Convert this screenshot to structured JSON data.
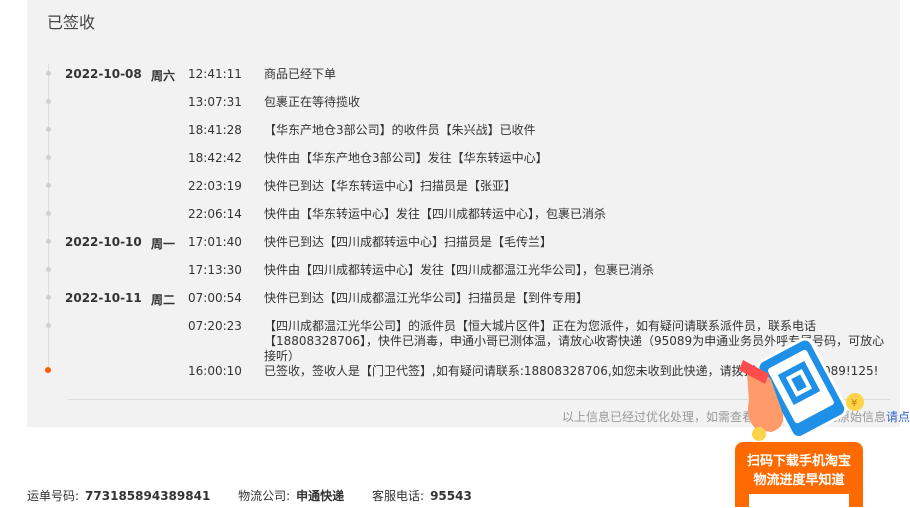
{
  "status_title": "已签收",
  "events": [
    {
      "date": "2022-10-08",
      "weekday": "周六",
      "time": "12:41:11",
      "msg": "商品已经下单"
    },
    {
      "date": "",
      "weekday": "",
      "time": "13:07:31",
      "msg": "包裹正在等待揽收"
    },
    {
      "date": "",
      "weekday": "",
      "time": "18:41:28",
      "msg": "【华东产地仓3部公司】的收件员【朱兴战】已收件"
    },
    {
      "date": "",
      "weekday": "",
      "time": "18:42:42",
      "msg": "快件由【华东产地仓3部公司】发往【华东转运中心】"
    },
    {
      "date": "",
      "weekday": "",
      "time": "22:03:19",
      "msg": "快件已到达【华东转运中心】扫描员是【张亚】"
    },
    {
      "date": "",
      "weekday": "",
      "time": "22:06:14",
      "msg": "快件由【华东转运中心】发往【四川成都转运中心】，包裹已消杀"
    },
    {
      "date": "2022-10-10",
      "weekday": "周一",
      "time": "17:01:40",
      "msg": "快件已到达【四川成都转运中心】扫描员是【毛传兰】"
    },
    {
      "date": "",
      "weekday": "",
      "time": "17:13:30",
      "msg": "快件由【四川成都转运中心】发往【四川成都温江光华公司】，包裹已消杀"
    },
    {
      "date": "2022-10-11",
      "weekday": "周二",
      "time": "07:00:54",
      "msg": "快件已到达【四川成都温江光华公司】扫描员是【到件专用】"
    },
    {
      "date": "",
      "weekday": "",
      "time": "07:20:23",
      "msg": "【四川成都温江光华公司】的派件员【恒大城片区件】正在为您派件，如有疑问请联系派件员，联系电话【18808328706】，快件已消毒，申通小哥已测体温，请放心收寄快递（95089为申通业务员外呼专属号码，可放心接听）"
    },
    {
      "date": "",
      "weekday": "",
      "time": "16:00:10",
      "msg": "已签收，签收人是【门卫代签】,如有疑问请联系:18808328706,如您未收到此快递，请拨打投诉电话:95089!125!"
    }
  ],
  "note": {
    "text": "以上信息已经过优化处理，如需查看快递公司提供的原始信息",
    "link": "请点击"
  },
  "waybill": {
    "label": "运单号码:",
    "value": "773185894389841"
  },
  "carrier": {
    "label": "物流公司:",
    "value": "申通快递"
  },
  "service": {
    "label": "客服电话:",
    "value": "95543"
  },
  "promo": {
    "line1": "扫码下载手机淘宝",
    "line2": "物流进度早知道"
  },
  "colors": {
    "accent": "#ff6a00",
    "link": "#3366cc",
    "active_dot": "#ff5a00"
  }
}
